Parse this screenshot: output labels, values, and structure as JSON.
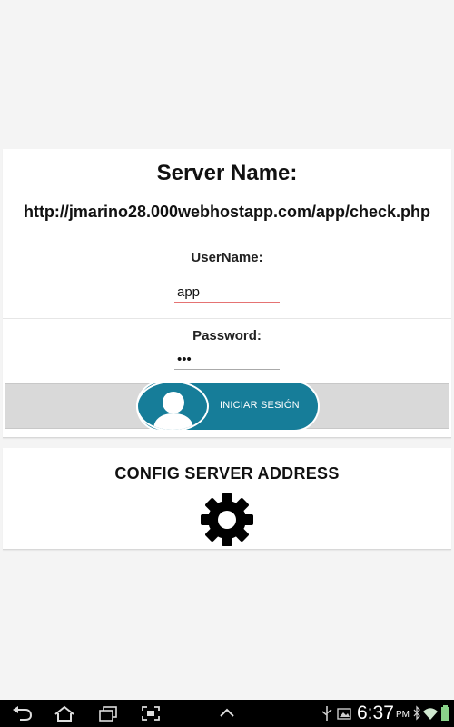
{
  "login": {
    "server_title": "Server Name:",
    "server_url": "http://jmarino28.000webhostapp.com/app/check.php",
    "username_label": "UserName:",
    "username_value": "app",
    "password_label": "Password:",
    "password_value": "•••",
    "login_button_label": "INICIAR SESIÓN"
  },
  "config": {
    "title": "CONFIG SERVER ADDRESS"
  },
  "statusbar": {
    "time": "6:37",
    "ampm": "PM"
  },
  "icons": {
    "avatar": "user-silhouette-icon",
    "config": "gear-icon"
  },
  "colors": {
    "accent": "#167d99",
    "focus_underline": "#e57373"
  }
}
